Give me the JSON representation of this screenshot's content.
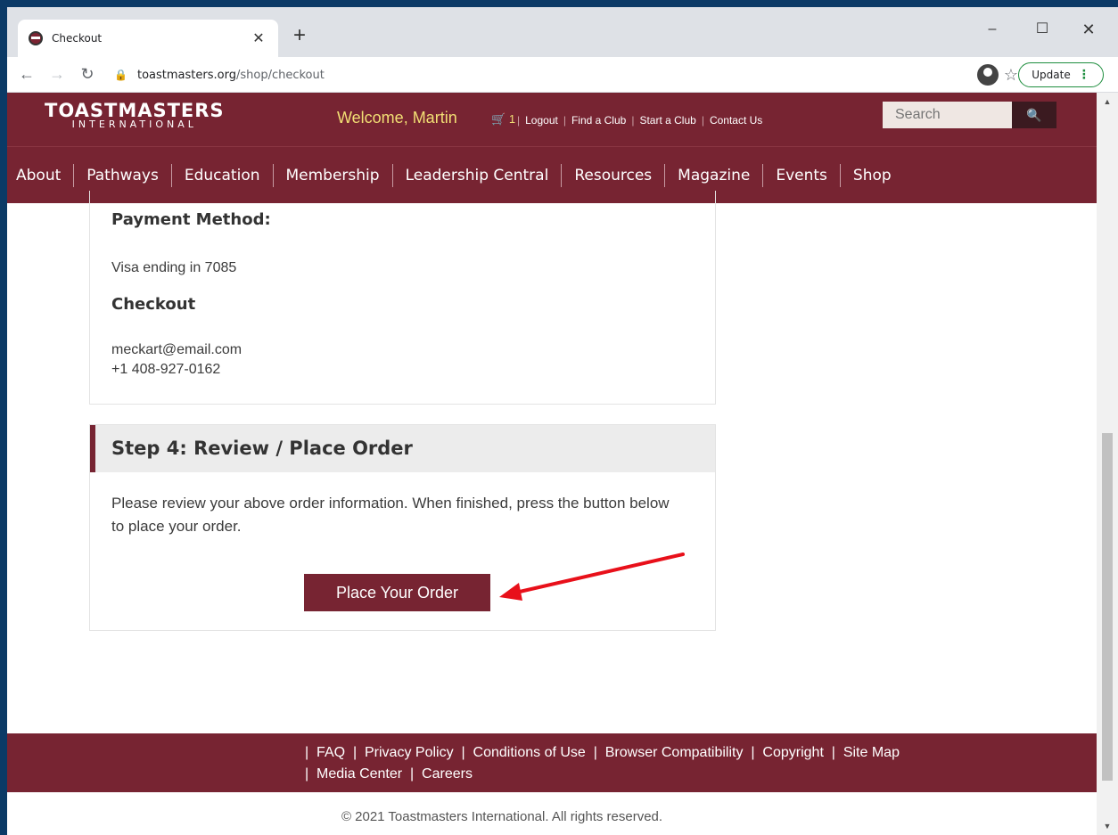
{
  "browser": {
    "tab_title": "Checkout",
    "url_domain": "toastmasters.org",
    "url_path": "/shop/checkout",
    "update_label": "Update",
    "new_tab_symbol": "+",
    "minimize_symbol": "–",
    "maximize_symbol": "☐",
    "close_symbol": "✕"
  },
  "site_header": {
    "logo_main": "TOASTMASTERS",
    "logo_sub": "INTERNATIONAL",
    "welcome": "Welcome, Martin",
    "cart_count": "1",
    "links": [
      "Logout",
      "Find a Club",
      "Start a Club",
      "Contact Us"
    ],
    "search_placeholder": "Search"
  },
  "main_nav": [
    "About",
    "Pathways",
    "Education",
    "Membership",
    "Leadership Central",
    "Resources",
    "Magazine",
    "Events",
    "Shop"
  ],
  "checkout": {
    "payment_heading": "Payment Method:",
    "payment_value": "Visa ending in 7085",
    "checkout_heading": "Checkout",
    "email": "meckart@email.com",
    "phone": "+1 408-927-0162",
    "step4_title": "Step 4: Review / Place Order",
    "step4_text": "Please review your above order information. When finished, press the button below to place your order.",
    "place_order_label": "Place Your Order"
  },
  "footer": {
    "links_line1": [
      "FAQ",
      "Privacy Policy",
      "Conditions of Use",
      "Browser Compatibility",
      "Copyright",
      "Site Map"
    ],
    "links_line2": [
      "Media Center",
      "Careers"
    ],
    "copyright": "© 2021 Toastmasters International.  All rights reserved."
  },
  "colors": {
    "brand": "#772432",
    "welcome_text": "#f2df74",
    "annotation_arrow": "#e8101a"
  }
}
